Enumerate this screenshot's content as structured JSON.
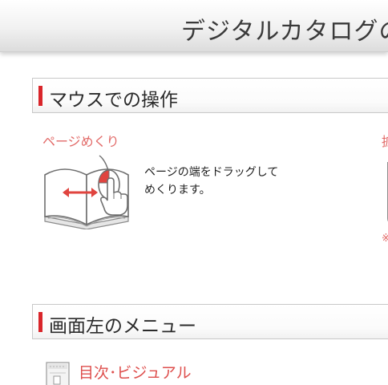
{
  "header": {
    "title": "デジタルカタログの"
  },
  "sections": {
    "mouse": {
      "title": "マウスでの操作",
      "page_turn": {
        "heading": "ページめくり",
        "description_line1": "ページの端をドラッグして",
        "description_line2": "めくります。"
      },
      "clipped_heading": "拡",
      "clipped_note": "※"
    },
    "menu": {
      "title": "画面左のメニュー",
      "toc": {
        "heading": "目次･ビジュアル"
      }
    }
  },
  "icons": {
    "book_mouse": "book-with-mouse-icon",
    "toc": "toc-document-icon"
  },
  "colors": {
    "accent_red": "#d9252a",
    "sub_heading": "#e26a68",
    "arrow_red": "#e0443f"
  }
}
